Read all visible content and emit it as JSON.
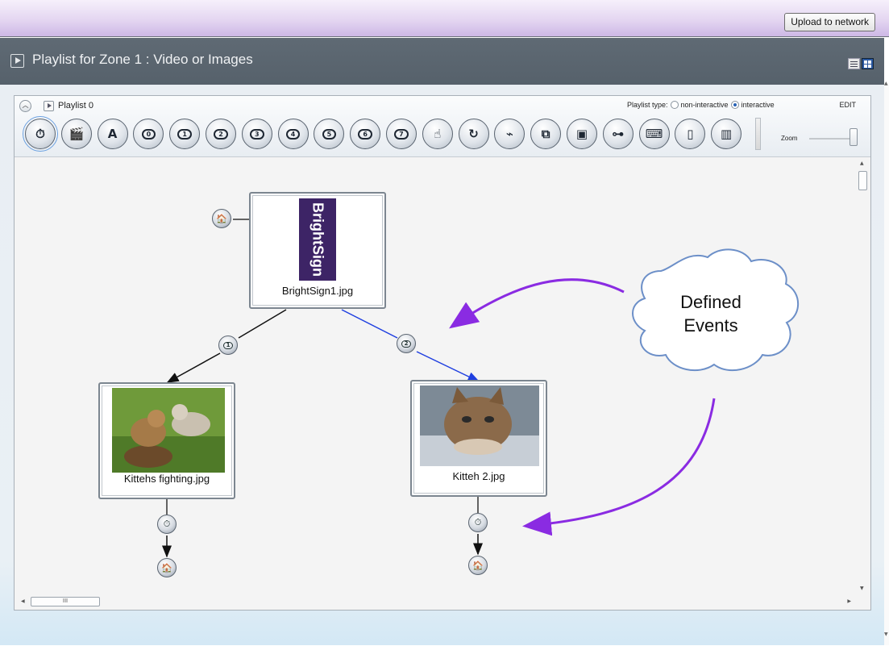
{
  "header": {
    "upload_button": "Upload to network"
  },
  "zone": {
    "title": "Playlist for Zone 1 : Video or Images"
  },
  "playlist": {
    "name": "Playlist 0",
    "type_label": "Playlist type:",
    "type_options": [
      "non-interactive",
      "interactive"
    ],
    "selected_type": "interactive",
    "edit_label": "EDIT",
    "zoom_label": "Zoom",
    "zoom_level": 1.0
  },
  "toolbar": {
    "tools": [
      {
        "name": "timer-event-icon",
        "glyph": "⏱"
      },
      {
        "name": "video-clip-icon",
        "glyph": "🎬"
      },
      {
        "name": "text-tool-icon",
        "glyph": "A"
      },
      {
        "name": "button-0-icon",
        "pill": "0"
      },
      {
        "name": "button-1-icon",
        "pill": "1"
      },
      {
        "name": "button-2-icon",
        "pill": "2"
      },
      {
        "name": "button-3-icon",
        "pill": "3"
      },
      {
        "name": "button-4-icon",
        "pill": "4"
      },
      {
        "name": "button-5-icon",
        "pill": "5"
      },
      {
        "name": "button-6-icon",
        "pill": "6"
      },
      {
        "name": "button-7-icon",
        "pill": "7"
      },
      {
        "name": "touch-event-icon",
        "glyph": "☝"
      },
      {
        "name": "loop-icon",
        "glyph": "↻"
      },
      {
        "name": "serial-cable-icon",
        "glyph": "⌁"
      },
      {
        "name": "zone-message-icon",
        "glyph": "⧉"
      },
      {
        "name": "display-icon",
        "glyph": "▣"
      },
      {
        "name": "usb-device-icon",
        "glyph": "⊶"
      },
      {
        "name": "keyboard-icon",
        "glyph": "⌨"
      },
      {
        "name": "remote-control-icon",
        "glyph": "▯"
      },
      {
        "name": "barcode-icon",
        "glyph": "▥"
      }
    ]
  },
  "nodes": [
    {
      "label": "BrightSign1.jpg",
      "image": "brightsign-logo",
      "logo_text": "BrightSign"
    },
    {
      "label": "Kittehs fighting.jpg",
      "image": "kittens-fighting-photo"
    },
    {
      "label": "Kitteh 2.jpg",
      "image": "kitten-photo"
    }
  ],
  "events": [
    {
      "name": "button-1-event",
      "pill": "1"
    },
    {
      "name": "button-2-event",
      "pill": "2"
    },
    {
      "name": "timer-event",
      "glyph": "⏱"
    },
    {
      "name": "home-icon",
      "glyph": "🏠"
    }
  ],
  "annotation": {
    "text_line1": "Defined",
    "text_line2": "Events"
  },
  "colors": {
    "accent": "#8a2be2",
    "edge_blue": "#1f3fe0",
    "zone_bar": "#5b6670",
    "brightsign_purple": "#3d2466"
  }
}
